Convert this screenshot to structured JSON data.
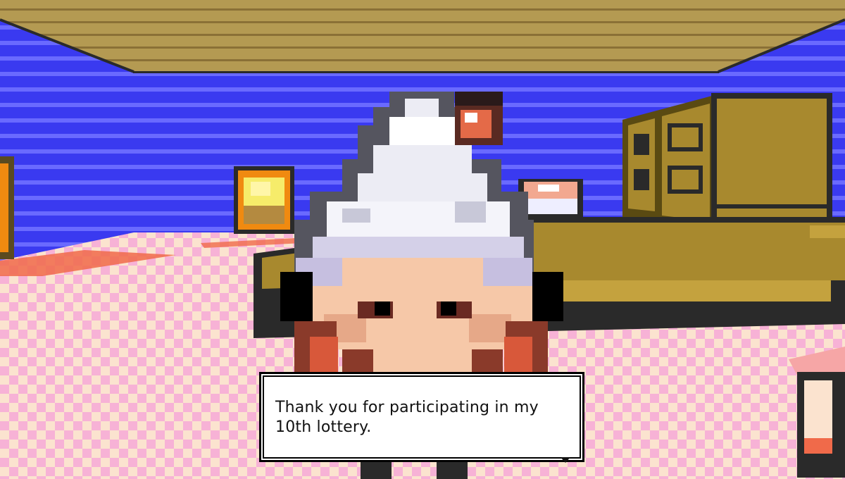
{
  "dialog": {
    "text": "Thank you for participating in my\n10th lottery.",
    "advance_icon": "triangle-down-icon"
  },
  "scene": {
    "wall_color": "#3a3af0",
    "wall_stripe_color": "#6a6aff",
    "ceiling_color": "#b49a52",
    "floor_pink": "#f7b2d6",
    "floor_cream": "#fbe3cf",
    "counter_color": "#a8892e",
    "npc_hair_color": "#ececf4"
  }
}
